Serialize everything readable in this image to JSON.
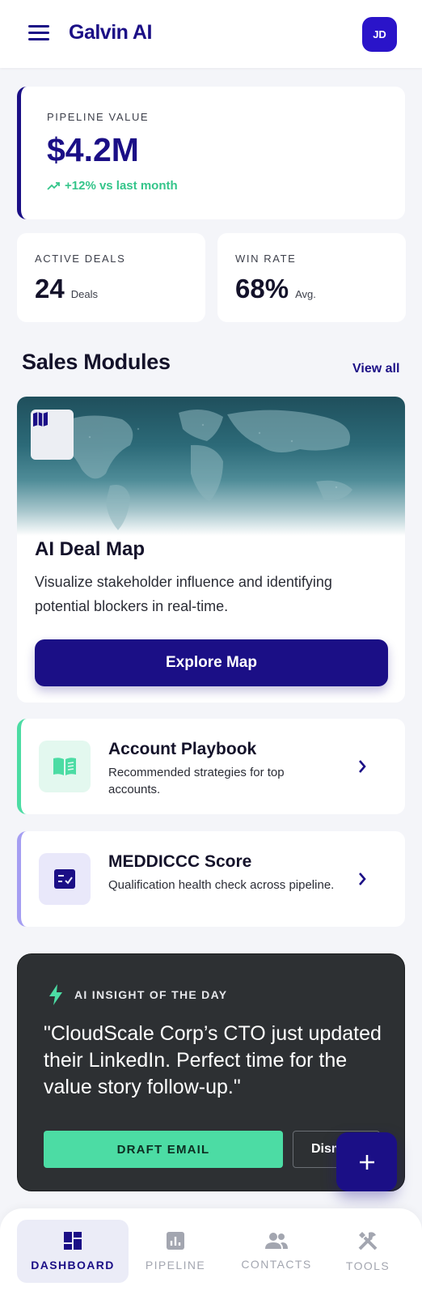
{
  "header": {
    "app_title": "Galvin AI",
    "avatar_initials": "JD"
  },
  "pipeline": {
    "label": "PIPELINE VALUE",
    "value": "$4.2M",
    "trend": "+12% vs last month"
  },
  "stats": {
    "active_deals": {
      "label": "ACTIVE DEALS",
      "value": "24",
      "unit": "Deals"
    },
    "win_rate": {
      "label": "WIN RATE",
      "value": "68%",
      "unit": "Avg."
    }
  },
  "modules_section": {
    "title": "Sales Modules",
    "view_all": "View all"
  },
  "deal_map": {
    "icon": "map-icon",
    "title": "AI Deal Map",
    "description": "Visualize stakeholder influence and identifying potential blockers in real-time.",
    "button": "Explore Map"
  },
  "modules": [
    {
      "icon": "book-icon",
      "title": "Account Playbook",
      "description": "Recommended strategies for top accounts.",
      "accent": "#4cdca4"
    },
    {
      "icon": "checklist-icon",
      "title": "MEDDICCC Score",
      "description": "Qualification health check across pipeline.",
      "accent": "#a59ef2"
    }
  ],
  "insight": {
    "label": "AI INSIGHT OF THE DAY",
    "quote": "\"CloudScale Corp’s CTO just updated their LinkedIn. Perfect time for the value story follow-up.\"",
    "primary_button": "DRAFT EMAIL",
    "secondary_button": "Dismiss"
  },
  "fab": {
    "icon": "plus-icon"
  },
  "bottom_nav": [
    {
      "label": "DASHBOARD",
      "icon": "dashboard-icon",
      "active": true
    },
    {
      "label": "PIPELINE",
      "icon": "bar-chart-icon",
      "active": false
    },
    {
      "label": "CONTACTS",
      "icon": "people-icon",
      "active": false
    },
    {
      "label": "TOOLS",
      "icon": "tools-icon",
      "active": false
    }
  ],
  "colors": {
    "brand": "#1b0f86",
    "accent_green": "#4cdca4",
    "accent_purple": "#a59ef2",
    "insight_bg": "#2d3033"
  }
}
